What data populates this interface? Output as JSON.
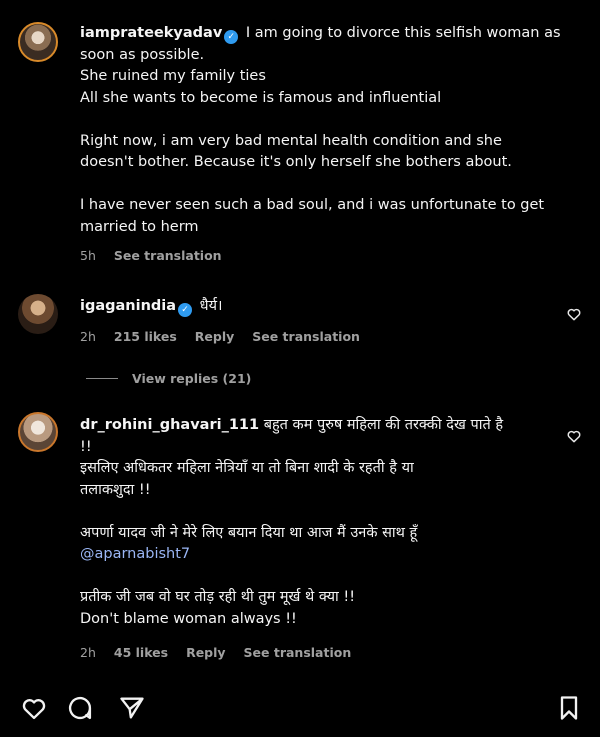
{
  "comments": [
    {
      "username": "iamprateekyadav",
      "verified": true,
      "lines": [
        "I am going to divorce this selfish woman as",
        "soon as possible.",
        "She ruined my family ties",
        "All she wants to become is famous and influential",
        "",
        "Right now, i am very bad mental health condition and she",
        "doesn't bother. Because it's only herself she bothers about.",
        "",
        "I have never seen such a bad soul, and i was unfortunate to get",
        "married to herm"
      ],
      "time": "5h",
      "see_translation": "See translation"
    },
    {
      "username": "igaganindia",
      "verified": true,
      "text": "धैर्य।",
      "time": "2h",
      "likes": "215 likes",
      "reply": "Reply",
      "see_translation": "See translation",
      "view_replies": "View replies (21)"
    },
    {
      "username": "dr_rohini_ghavari_111",
      "first_line": "बहुत कम पुरुष महिला की तरक्की देख पाते है",
      "lines": [
        "!!",
        "इसलिए अधिकतर महिला नेत्रियाँ या तो बिना शादी के रहती है या",
        "तलाकशुदा !!",
        "",
        "अपर्णा यादव जी ने मेरे लिए बयान दिया था आज मैं उनके साथ हूँ"
      ],
      "mention": "@aparnabisht7",
      "lines2": [
        "",
        "प्रतीक जी जब वो घर तोड़ रही थी तुम मूर्ख थे क्या !!",
        "Don't blame woman always !!"
      ],
      "time": "2h",
      "likes": "45 likes",
      "reply": "Reply",
      "see_translation": "See translation"
    }
  ],
  "icons": {
    "verified": "✓",
    "like": "heart-icon",
    "comment": "comment-icon",
    "share": "send-icon",
    "save": "bookmark-icon"
  },
  "colors": {
    "background": "#000000",
    "verified": "#2f9bf0",
    "mention": "#9ab6f5",
    "meta": "#a0a0a0"
  }
}
